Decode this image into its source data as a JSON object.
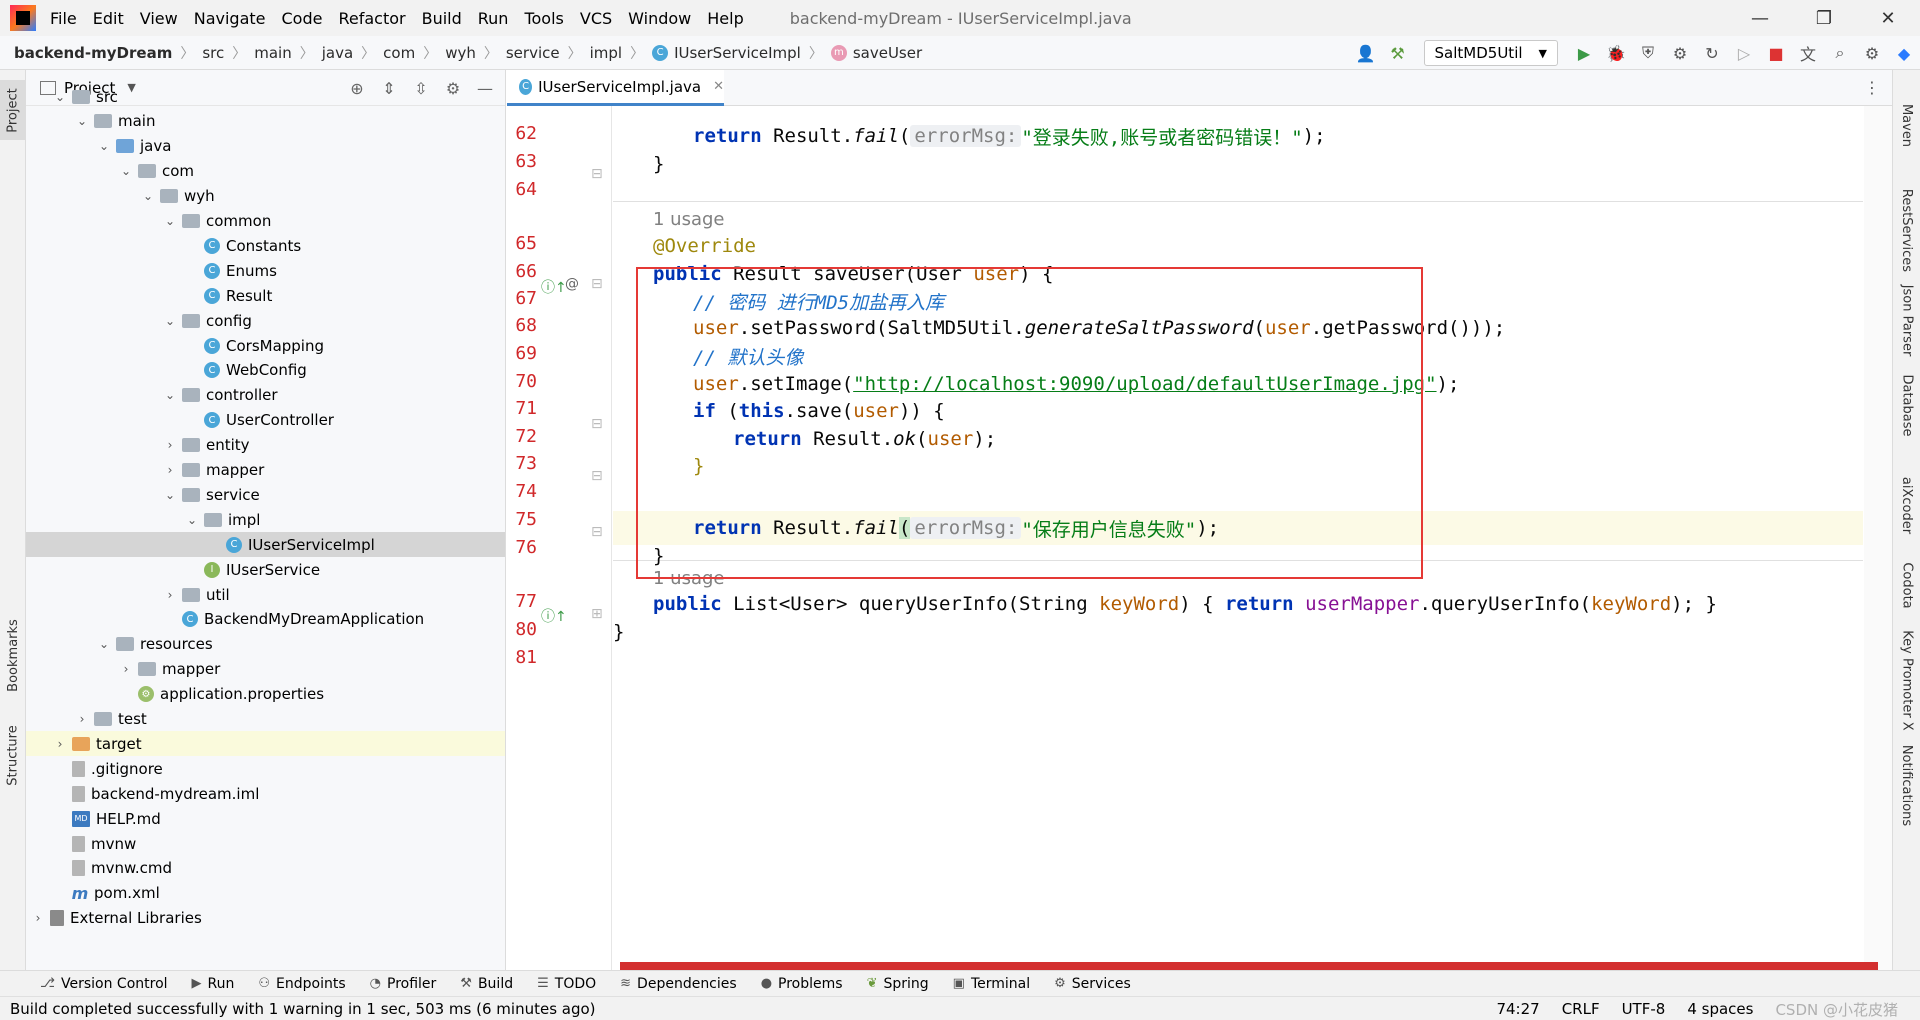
{
  "titlebar": {
    "menu": [
      "File",
      "Edit",
      "View",
      "Navigate",
      "Code",
      "Refactor",
      "Build",
      "Run",
      "Tools",
      "VCS",
      "Window",
      "Help"
    ],
    "title": "backend-myDream - IUserServiceImpl.java"
  },
  "navbar": {
    "crumbs": [
      "backend-myDream",
      "src",
      "main",
      "java",
      "com",
      "wyh",
      "service",
      "impl"
    ],
    "class_crumb": "IUserServiceImpl",
    "method_crumb": "saveUser",
    "run_config": "SaltMD5Util"
  },
  "project": {
    "title": "Project",
    "tree": [
      {
        "label": "src",
        "depth": 1,
        "kind": "folder-gray",
        "chev": "v"
      },
      {
        "label": "main",
        "depth": 2,
        "kind": "folder-gray",
        "chev": "v"
      },
      {
        "label": "java",
        "depth": 3,
        "kind": "folder-blue",
        "chev": "v"
      },
      {
        "label": "com",
        "depth": 4,
        "kind": "pkg",
        "chev": "v"
      },
      {
        "label": "wyh",
        "depth": 5,
        "kind": "pkg",
        "chev": "v"
      },
      {
        "label": "common",
        "depth": 6,
        "kind": "pkg",
        "chev": "v"
      },
      {
        "label": "Constants",
        "depth": 7,
        "kind": "class"
      },
      {
        "label": "Enums",
        "depth": 7,
        "kind": "class"
      },
      {
        "label": "Result",
        "depth": 7,
        "kind": "class"
      },
      {
        "label": "config",
        "depth": 6,
        "kind": "pkg",
        "chev": "v"
      },
      {
        "label": "CorsMapping",
        "depth": 7,
        "kind": "class"
      },
      {
        "label": "WebConfig",
        "depth": 7,
        "kind": "class"
      },
      {
        "label": "controller",
        "depth": 6,
        "kind": "pkg",
        "chev": "v"
      },
      {
        "label": "UserController",
        "depth": 7,
        "kind": "class"
      },
      {
        "label": "entity",
        "depth": 6,
        "kind": "pkg",
        "chev": ">"
      },
      {
        "label": "mapper",
        "depth": 6,
        "kind": "pkg",
        "chev": ">"
      },
      {
        "label": "service",
        "depth": 6,
        "kind": "pkg",
        "chev": "v"
      },
      {
        "label": "impl",
        "depth": 7,
        "kind": "pkg",
        "chev": "v"
      },
      {
        "label": "IUserServiceImpl",
        "depth": 8,
        "kind": "class",
        "state": "selected"
      },
      {
        "label": "IUserService",
        "depth": 7,
        "kind": "interface"
      },
      {
        "label": "util",
        "depth": 6,
        "kind": "pkg",
        "chev": ">"
      },
      {
        "label": "BackendMyDreamApplication",
        "depth": 6,
        "kind": "class"
      },
      {
        "label": "resources",
        "depth": 3,
        "kind": "folder-gray",
        "chev": "v"
      },
      {
        "label": "mapper",
        "depth": 4,
        "kind": "folder-gray",
        "chev": ">"
      },
      {
        "label": "application.properties",
        "depth": 4,
        "kind": "prop"
      },
      {
        "label": "test",
        "depth": 2,
        "kind": "folder-gray",
        "chev": ">"
      },
      {
        "label": "target",
        "depth": 1,
        "kind": "folder-orange",
        "chev": ">",
        "state": "highlight"
      },
      {
        "label": ".gitignore",
        "depth": 1,
        "kind": "doc"
      },
      {
        "label": "backend-mydream.iml",
        "depth": 1,
        "kind": "doc"
      },
      {
        "label": "HELP.md",
        "depth": 1,
        "kind": "md"
      },
      {
        "label": "mvnw",
        "depth": 1,
        "kind": "doc"
      },
      {
        "label": "mvnw.cmd",
        "depth": 1,
        "kind": "doc"
      },
      {
        "label": "pom.xml",
        "depth": 1,
        "kind": "maven"
      },
      {
        "label": "External Libraries",
        "depth": 0,
        "kind": "lib",
        "chev": ">"
      }
    ]
  },
  "editor": {
    "tab_label": "IUserServiceImpl.java",
    "usage_label": "1 usage",
    "line_numbers": [
      "62",
      "63",
      "64",
      "65",
      "66",
      "67",
      "68",
      "69",
      "70",
      "71",
      "72",
      "73",
      "74",
      "75",
      "76",
      "77",
      "80",
      "81"
    ],
    "code": {
      "l62_a": "return",
      "l62_b": " Result.",
      "l62_c": "fail",
      "l62_d": "(",
      "l62_hint": "errorMsg:",
      "l62_str": "\"登录失败,账号或者密码错误！\"",
      "l62_e": ");",
      "l63": "}",
      "l65": "@Override",
      "l66_kw": "public",
      "l66_a": " Result saveUser(User ",
      "l66_p": "user",
      "l66_b": ") {",
      "l67": "// 密码 进行MD5加盐再入库",
      "l68_p": "user",
      "l68_a": ".setPassword(SaltMD5Util.",
      "l68_it": "generateSaltPassword",
      "l68_b": "(",
      "l68_p2": "user",
      "l68_c": ".getPassword()));",
      "l69": "// 默认头像",
      "l70_p": "user",
      "l70_a": ".setImage(",
      "l70_url": "\"http://localhost:9090/upload/defaultUserImage.jpg\"",
      "l70_b": ");",
      "l71_kw": "if",
      "l71_a": " (",
      "l71_kw2": "this",
      "l71_b": ".save(",
      "l71_p": "user",
      "l71_c": ")) {",
      "l72_kw": "return",
      "l72_a": " Result.",
      "l72_it": "ok",
      "l72_b": "(",
      "l72_p": "user",
      "l72_c": ");",
      "l73": "}",
      "l74_kw": "return",
      "l74_a": " Result.",
      "l74_it": "fail",
      "l74_b": "(",
      "l74_hint": "errorMsg:",
      "l74_str": "\"保存用户信息失败\"",
      "l74_c": ");",
      "l75": "}",
      "l77_kw": "public",
      "l77_a": " List<User> queryUserInfo(String ",
      "l77_p": "keyWord",
      "l77_b": ") { ",
      "l77_kw2": "return",
      "l77_f": " userMapper",
      "l77_c": ".queryUserInfo(",
      "l77_p2": "keyWord",
      "l77_d": "); }",
      "l80": "}"
    }
  },
  "left_strip": {
    "top_tab": "Project",
    "bookmarks": "Bookmarks",
    "structure": "Structure"
  },
  "right_strip": {
    "tabs": [
      "Maven",
      "RestServices",
      "Json Parser",
      "Database",
      "aiXcoder",
      "Codota",
      "Key Promoter X",
      "Notifications"
    ]
  },
  "bottom_tools": [
    "Version Control",
    "Run",
    "Endpoints",
    "Profiler",
    "Build",
    "TODO",
    "Dependencies",
    "Problems",
    "Spring",
    "Terminal",
    "Services"
  ],
  "status": {
    "message": "Build completed successfully with 1 warning in 1 sec, 503 ms (6 minutes ago)",
    "position": "74:27",
    "line_sep": "CRLF",
    "encoding": "UTF-8",
    "indent": "4 spaces",
    "watermark": "CSDN @小花皮猪"
  }
}
